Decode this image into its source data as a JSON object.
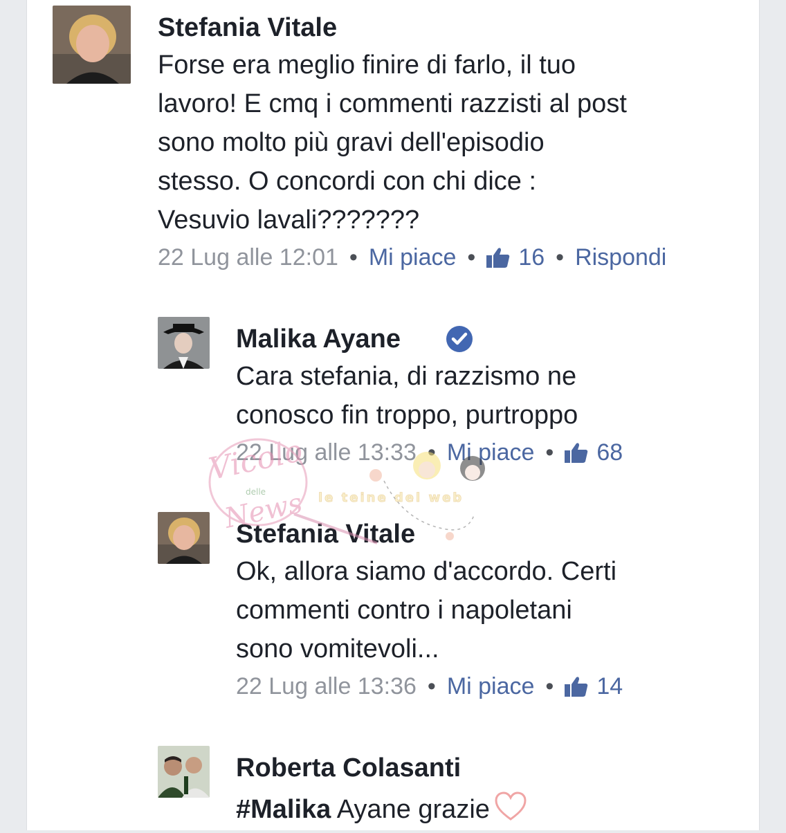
{
  "comments": [
    {
      "author": "Stefania Vitale",
      "lines": [
        "Forse era meglio finire di farlo, il tuo",
        "lavoro! E cmq i commenti razzisti al post",
        "sono molto più gravi dell'episodio",
        "stesso. O concordi con chi dice :",
        "Vesuvio lavali???????"
      ],
      "timestamp": "22 Lug alle 12:01",
      "like_label": "Mi piace",
      "like_count": "16",
      "reply_label": "Rispondi"
    },
    {
      "author": "Malika Ayane",
      "verified": true,
      "lines": [
        "Cara stefania, di razzismo ne",
        "conosco fin troppo,  purtroppo"
      ],
      "timestamp": "22 Lug alle 13:33",
      "like_label": "Mi piace",
      "like_count": "68"
    },
    {
      "author": "Stefania Vitale",
      "lines": [
        "Ok, allora siamo d'accordo. Certi",
        "commenti contro i napoletani",
        "sono vomitevoli..."
      ],
      "timestamp": "22 Lug alle 13:36",
      "like_label": "Mi piace",
      "like_count": "14"
    },
    {
      "author": "Roberta Colasanti",
      "hashtag": "#Malika",
      "text_rest": " Ayane grazie"
    }
  ],
  "watermark": {
    "logo_text": "Vicolo delle News",
    "secondary_text": "le teine del web"
  },
  "colors": {
    "text": "#1d2129",
    "meta_gray": "#90949c",
    "link_blue": "#4b67a1",
    "verified_blue": "#4267b2",
    "heart": "#f0a5a5"
  }
}
